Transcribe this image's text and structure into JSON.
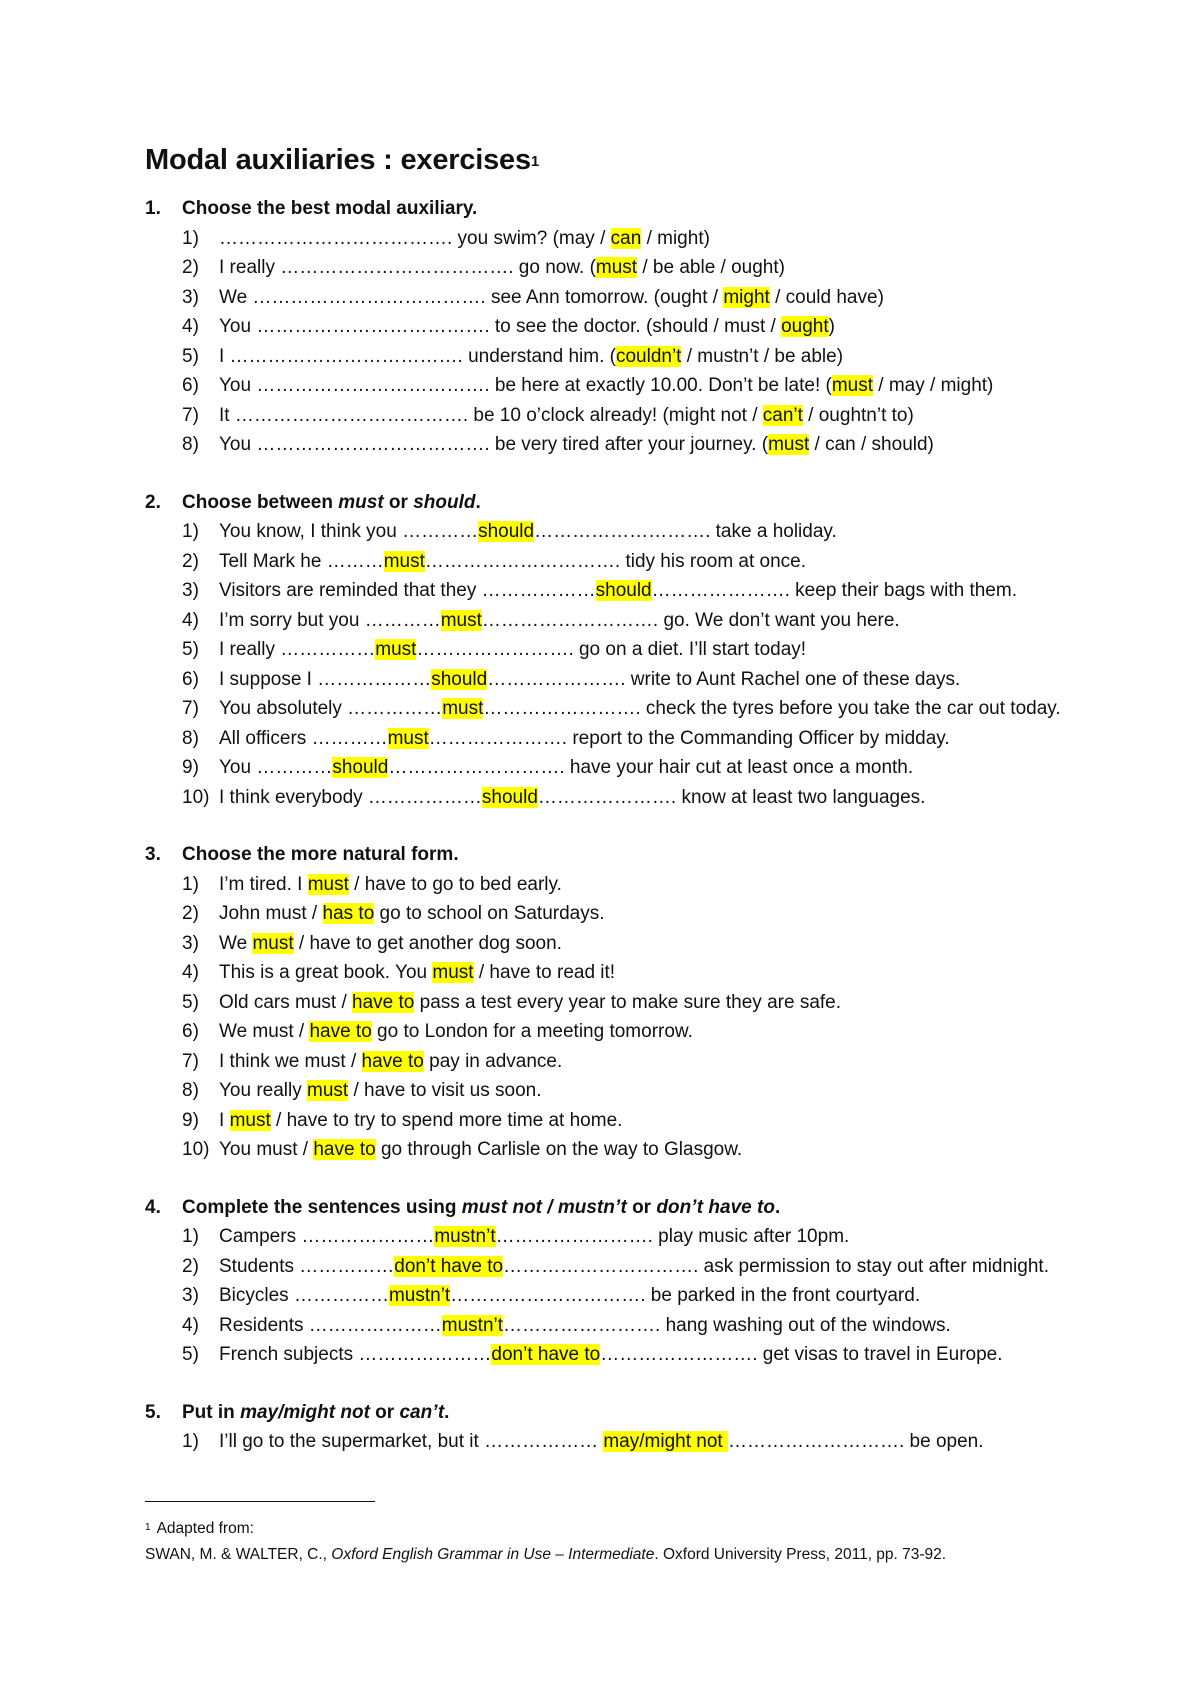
{
  "document": {
    "title": "Modal auxiliaries : exercises",
    "title_footnote_ref": "1",
    "highlight_color": "#ffff00"
  },
  "sections": [
    {
      "number": "1.",
      "heading": [
        {
          "t": "Choose the best modal auxiliary.",
          "i": false
        }
      ],
      "items": [
        {
          "n": "1)",
          "parts": [
            {
              "t": "………………………………. you swim? (may / "
            },
            {
              "t": "can",
              "h": true
            },
            {
              "t": " / might)"
            }
          ]
        },
        {
          "n": "2)",
          "parts": [
            {
              "t": "I really ………………………………. go now. ("
            },
            {
              "t": "must",
              "h": true
            },
            {
              "t": " / be able / ought)"
            }
          ]
        },
        {
          "n": "3)",
          "parts": [
            {
              "t": "We ………………………………. see Ann tomorrow. (ought / "
            },
            {
              "t": "might",
              "h": true
            },
            {
              "t": " / could have)"
            }
          ]
        },
        {
          "n": "4)",
          "parts": [
            {
              "t": "You ………………………………. to see the doctor. (should / must / "
            },
            {
              "t": "ought",
              "h": true
            },
            {
              "t": ")"
            }
          ]
        },
        {
          "n": "5)",
          "parts": [
            {
              "t": "I ………………………………. understand him. ("
            },
            {
              "t": "couldn’t",
              "h": true
            },
            {
              "t": " / mustn’t / be able)"
            }
          ]
        },
        {
          "n": "6)",
          "parts": [
            {
              "t": "You ………………………………. be here at exactly 10.00. Don’t be late! ("
            },
            {
              "t": "must",
              "h": true
            },
            {
              "t": " / may / might)"
            }
          ]
        },
        {
          "n": "7)",
          "parts": [
            {
              "t": "It ………………………………. be 10 o’clock already! (might not / "
            },
            {
              "t": "can’t",
              "h": true
            },
            {
              "t": " / oughtn’t to)"
            }
          ]
        },
        {
          "n": "8)",
          "parts": [
            {
              "t": "You ………………………………. be very tired after your journey. ("
            },
            {
              "t": "must",
              "h": true
            },
            {
              "t": " / can / should)"
            }
          ]
        }
      ]
    },
    {
      "number": "2.",
      "heading": [
        {
          "t": "Choose between ",
          "i": false
        },
        {
          "t": "must",
          "i": true
        },
        {
          "t": " or ",
          "i": false
        },
        {
          "t": "should",
          "i": true
        },
        {
          "t": ".",
          "i": false
        }
      ],
      "items": [
        {
          "n": "1)",
          "parts": [
            {
              "t": "You know, I think you …………"
            },
            {
              "t": "should",
              "h": true
            },
            {
              "t": "………………………. take a holiday."
            }
          ]
        },
        {
          "n": "2)",
          "parts": [
            {
              "t": "Tell Mark he ………"
            },
            {
              "t": "must",
              "h": true
            },
            {
              "t": "…………………………. tidy his room at once."
            }
          ]
        },
        {
          "n": "3)",
          "parts": [
            {
              "t": "Visitors are reminded that they ………………"
            },
            {
              "t": "should",
              "h": true
            },
            {
              "t": "…………………. keep their bags with them."
            }
          ]
        },
        {
          "n": "4)",
          "parts": [
            {
              "t": "I’m sorry but you …………"
            },
            {
              "t": "must",
              "h": true
            },
            {
              "t": "………………………. go. We don’t want you here."
            }
          ]
        },
        {
          "n": "5)",
          "parts": [
            {
              "t": "I really ……………"
            },
            {
              "t": "must",
              "h": true
            },
            {
              "t": "……………………. go on a diet. I’ll start today!"
            }
          ]
        },
        {
          "n": "6)",
          "parts": [
            {
              "t": "I suppose I ………………"
            },
            {
              "t": "should",
              "h": true
            },
            {
              "t": "…………………. write to Aunt Rachel one of these days."
            }
          ]
        },
        {
          "n": "7)",
          "parts": [
            {
              "t": "You absolutely ……………"
            },
            {
              "t": "must",
              "h": true
            },
            {
              "t": "……………………. check the tyres before you take the car out today."
            }
          ]
        },
        {
          "n": "8)",
          "parts": [
            {
              "t": "All officers …………"
            },
            {
              "t": "must",
              "h": true
            },
            {
              "t": "…………………. report to the Commanding Officer by midday."
            }
          ]
        },
        {
          "n": "9)",
          "parts": [
            {
              "t": "You …………"
            },
            {
              "t": "should",
              "h": true
            },
            {
              "t": "………………………. have your hair cut at least once a month."
            }
          ]
        },
        {
          "n": "10)",
          "parts": [
            {
              "t": "I think everybody ………………"
            },
            {
              "t": "should",
              "h": true
            },
            {
              "t": "…………………. know at least two languages."
            }
          ]
        }
      ]
    },
    {
      "number": "3.",
      "heading": [
        {
          "t": "Choose the more natural form.",
          "i": false
        }
      ],
      "items": [
        {
          "n": "1)",
          "parts": [
            {
              "t": "I’m tired. I "
            },
            {
              "t": "must",
              "h": true
            },
            {
              "t": " / have to go to bed early."
            }
          ]
        },
        {
          "n": "2)",
          "parts": [
            {
              "t": "John must / "
            },
            {
              "t": "has to",
              "h": true
            },
            {
              "t": " go to school on Saturdays."
            }
          ]
        },
        {
          "n": "3)",
          "parts": [
            {
              "t": "We "
            },
            {
              "t": "must",
              "h": true
            },
            {
              "t": " / have to get another dog soon."
            }
          ]
        },
        {
          "n": "4)",
          "parts": [
            {
              "t": "This is a great book. You "
            },
            {
              "t": "must",
              "h": true
            },
            {
              "t": " / have to read it!"
            }
          ]
        },
        {
          "n": "5)",
          "parts": [
            {
              "t": "Old cars must / "
            },
            {
              "t": "have to",
              "h": true
            },
            {
              "t": " pass a test every year to make sure they are safe."
            }
          ]
        },
        {
          "n": "6)",
          "parts": [
            {
              "t": "We must / "
            },
            {
              "t": "have to",
              "h": true
            },
            {
              "t": " go to London for a meeting tomorrow."
            }
          ]
        },
        {
          "n": "7)",
          "parts": [
            {
              "t": "I think we must / "
            },
            {
              "t": "have to",
              "h": true
            },
            {
              "t": " pay in advance."
            }
          ]
        },
        {
          "n": "8)",
          "parts": [
            {
              "t": "You really "
            },
            {
              "t": "must",
              "h": true
            },
            {
              "t": " / have to visit us soon."
            }
          ]
        },
        {
          "n": "9)",
          "parts": [
            {
              "t": "I "
            },
            {
              "t": "must",
              "h": true
            },
            {
              "t": " / have to try to spend more time at home."
            }
          ]
        },
        {
          "n": "10)",
          "parts": [
            {
              "t": "You must / "
            },
            {
              "t": "have to",
              "h": true
            },
            {
              "t": " go through Carlisle on the way to Glasgow."
            }
          ]
        }
      ]
    },
    {
      "number": "4.",
      "heading": [
        {
          "t": "Complete the sentences using ",
          "i": false
        },
        {
          "t": "must not / mustn’t",
          "i": true
        },
        {
          "t": " or ",
          "i": false
        },
        {
          "t": "don’t have to",
          "i": true
        },
        {
          "t": ".",
          "i": false
        }
      ],
      "items": [
        {
          "n": "1)",
          "parts": [
            {
              "t": "Campers …………………"
            },
            {
              "t": "mustn’t",
              "h": true
            },
            {
              "t": "……………………. play music after 10pm."
            }
          ]
        },
        {
          "n": "2)",
          "parts": [
            {
              "t": "Students ……………"
            },
            {
              "t": "don’t have to",
              "h": true
            },
            {
              "t": "…………………………. ask permission to stay out after midnight."
            }
          ]
        },
        {
          "n": "3)",
          "parts": [
            {
              "t": "Bicycles ……………"
            },
            {
              "t": "mustn’t",
              "h": true
            },
            {
              "t": "…………………………. be parked in the front courtyard."
            }
          ]
        },
        {
          "n": "4)",
          "parts": [
            {
              "t": "Residents …………………"
            },
            {
              "t": "mustn’t",
              "h": true
            },
            {
              "t": "……………………. hang washing out of the windows."
            }
          ]
        },
        {
          "n": "5)",
          "parts": [
            {
              "t": "French subjects …………………"
            },
            {
              "t": "don’t have to",
              "h": true
            },
            {
              "t": "……………………. get visas to travel in Europe."
            }
          ]
        }
      ]
    },
    {
      "number": "5.",
      "heading": [
        {
          "t": "Put in ",
          "i": false
        },
        {
          "t": "may/might not",
          "i": true
        },
        {
          "t": " or ",
          "i": false
        },
        {
          "t": "can’t",
          "i": true
        },
        {
          "t": ".",
          "i": false
        }
      ],
      "items": [
        {
          "n": "1)",
          "parts": [
            {
              "t": "I’ll go to the supermarket, but it ……………… "
            },
            {
              "t": "may/might not ",
              "h": true
            },
            {
              "t": "………………………. be open."
            }
          ]
        }
      ]
    }
  ],
  "footnote": {
    "ref": "1",
    "line1": "Adapted from:",
    "citation_authors": "SWAN, M. & WALTER, C., ",
    "citation_title": "Oxford English Grammar in Use – Intermediate",
    "citation_rest": ". Oxford University Press, 2011, pp. 73-92."
  }
}
